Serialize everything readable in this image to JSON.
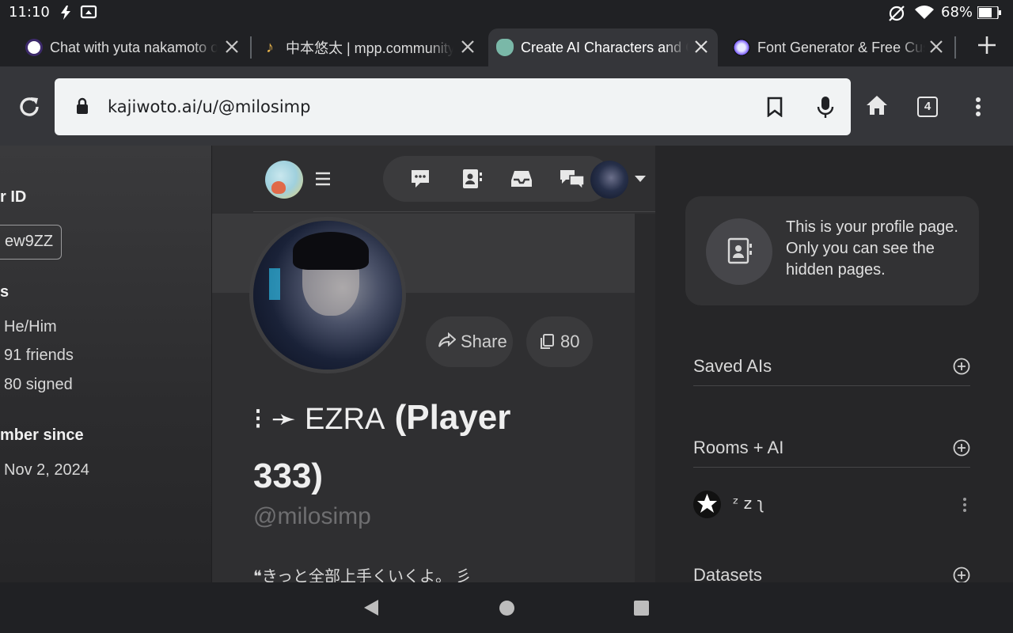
{
  "status_bar": {
    "time": "11:10",
    "battery": "68%",
    "icons": [
      "flash-icon",
      "cast-icon",
      "no-sync-icon",
      "wifi-icon",
      "battery-icon"
    ]
  },
  "tabs": [
    {
      "title": "Chat with yuta nakamoto on",
      "favicon": "kajiwoto-icon"
    },
    {
      "title": "中本悠太 | mpp.community",
      "favicon": "music-note-icon"
    },
    {
      "title": "Create AI Characters and Ch",
      "favicon": "kajiwoto-pet-icon",
      "active": true
    },
    {
      "title": "Font Generator & Free Custom",
      "favicon": "planet-icon"
    }
  ],
  "toolbar": {
    "url": "kajiwoto.ai/u/@milosimp",
    "tab_count": "4"
  },
  "left_panel": {
    "id_label": "r ID",
    "id_value": "ew9ZZ",
    "stats_label": "s",
    "pronouns": "He/Him",
    "friends": "91 friends",
    "signed": "80 signed",
    "member_label": "mber since",
    "member_value": "Nov 2, 2024"
  },
  "profile": {
    "share_label": "Share",
    "copies": "80",
    "title_line1_prefix": "⁝ ➛ EZRA",
    "title_line1_rest": "(Player",
    "title_line2": "333)",
    "handle": "@milosimp",
    "bio": "❝きっと全部上手くいくよ。 彡"
  },
  "right_panel": {
    "info_text": "This is your profile page. Only you can see the hidden pages.",
    "saved_ais": "Saved AIs",
    "rooms": "Rooms + AI",
    "room_item": "ᶻ z ʅ",
    "datasets": "Datasets"
  },
  "colors": {
    "bg": "#2f2f31",
    "accent_pill": "#3b3b3d"
  }
}
